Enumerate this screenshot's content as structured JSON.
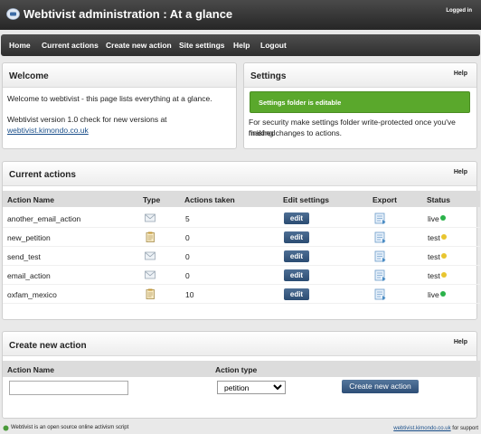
{
  "header": {
    "title": "Webtivist administration : At a glance",
    "logged_in": "Logged in"
  },
  "nav": [
    "Home",
    "Current actions",
    "Create new action",
    "Site settings",
    "Help",
    "Logout"
  ],
  "welcome": {
    "title": "Welcome",
    "line1": "Welcome to webtivist - this page lists everything at a glance.",
    "line2": "Webtivist version 1.0 check for new versions at",
    "link": "webtivist.kimondo.co.uk"
  },
  "settings": {
    "title": "Settings",
    "help": "Help",
    "success": "Settings folder is editable",
    "note1": "For security make settings folder write-protected once you've finished",
    "note2": "making changes to actions."
  },
  "current_actions": {
    "title": "Current actions",
    "help": "Help",
    "headers": [
      "Action Name",
      "Type",
      "Actions taken",
      "Edit settings",
      "Export",
      "Status"
    ],
    "edit_label": "edit",
    "rows": [
      {
        "name": "another_email_action",
        "type": "email-icon",
        "taken": "5",
        "status": "live",
        "status_color": "#2bb24a"
      },
      {
        "name": "new_petition",
        "type": "petition-icon",
        "taken": "0",
        "status": "test",
        "status_color": "#e8c530"
      },
      {
        "name": "send_test",
        "type": "email-icon",
        "taken": "0",
        "status": "test",
        "status_color": "#e8c530"
      },
      {
        "name": "email_action",
        "type": "email-icon",
        "taken": "0",
        "status": "test",
        "status_color": "#e8c530"
      },
      {
        "name": "oxfam_mexico",
        "type": "petition-icon",
        "taken": "10",
        "status": "live",
        "status_color": "#2bb24a"
      }
    ]
  },
  "create": {
    "title": "Create new action",
    "help": "Help",
    "name_header": "Action Name",
    "type_header": "Action type",
    "name_value": "",
    "type_selected": "petition",
    "button": "Create new action"
  },
  "footer": {
    "left": "Webtivist is an open source online activism script",
    "right_link": "webtivist.kimondo.co.uk",
    "right_text": " for support"
  }
}
